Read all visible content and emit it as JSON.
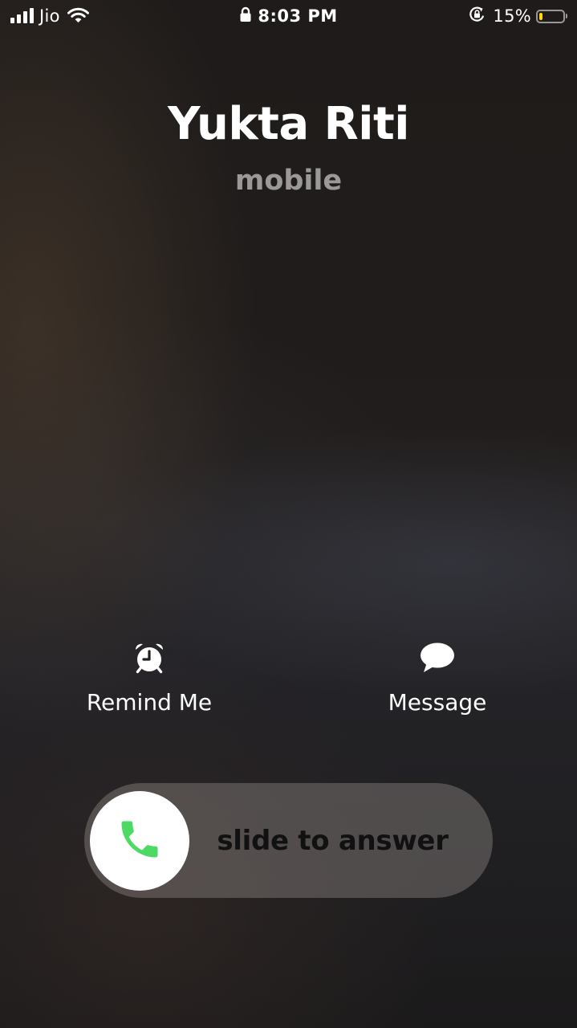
{
  "status_bar": {
    "carrier": "Jio",
    "signal_bars": 4,
    "time": "8:03 PM",
    "lock_icon": "lock-icon",
    "orientation_lock_icon": "orientation-lock-icon",
    "battery_percent_text": "15%",
    "battery_level": 0.15,
    "battery_color": "#ffd60a"
  },
  "caller": {
    "name": "Yukta Riti",
    "label": "mobile"
  },
  "actions": {
    "remind": {
      "label": "Remind Me",
      "icon": "alarm-clock-icon"
    },
    "message": {
      "label": "Message",
      "icon": "message-bubble-icon"
    }
  },
  "slider": {
    "label": "slide to answer",
    "icon": "phone-icon",
    "icon_color": "#4cd964"
  }
}
